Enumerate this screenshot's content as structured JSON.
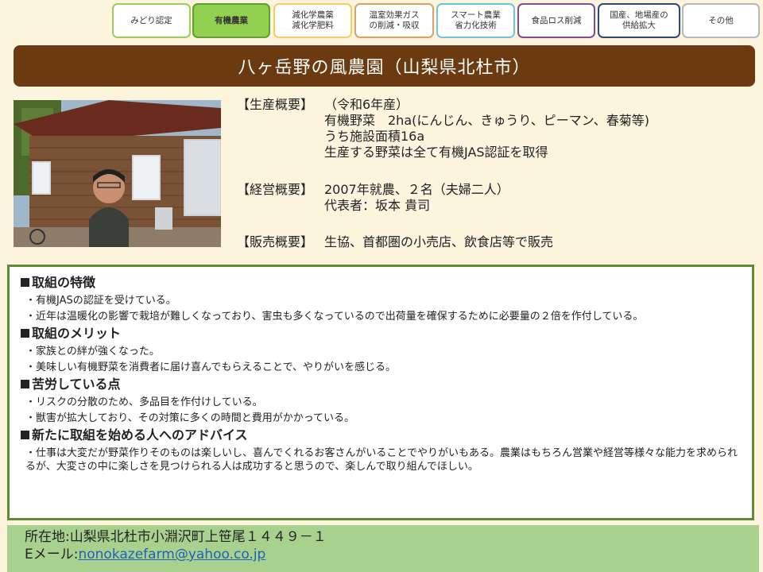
{
  "tabs": [
    {
      "label": "みどり認定",
      "color": "#9ccc5c",
      "active": false
    },
    {
      "label": "有機農業",
      "color": "#5fa02e",
      "active": true,
      "fill": "#92d050"
    },
    {
      "label": "減化学農薬\n減化学肥料",
      "color": "#f0d060",
      "active": false
    },
    {
      "label": "温室効果ガス\nの削減・吸収",
      "color": "#d9a36a",
      "active": false
    },
    {
      "label": "スマート農業\n省力化技術",
      "color": "#6cc7da",
      "active": false
    },
    {
      "label": "食品ロス削減",
      "color": "#7d4d9c",
      "active": false
    },
    {
      "label": "国産、地場産の\n供給拡大",
      "color": "#2e4a7a",
      "active": false
    },
    {
      "label": "その他",
      "color": "#b8b8b8",
      "active": false
    }
  ],
  "page_title": "八ヶ岳野の風農園（山梨県北杜市）",
  "summary": {
    "production": {
      "label": "【生産概要】",
      "lines": [
        "（令和6年産）",
        "有機野菜　2ha(にんじん、きゅうり、ピーマン、春菊等)",
        "うち施設面積16a",
        "生産する野菜は全て有機JAS認証を取得"
      ]
    },
    "management": {
      "label": "【経営概要】",
      "lines": [
        "2007年就農、２名（夫婦二人）",
        "代表者：坂本 貴司"
      ]
    },
    "sales": {
      "label": "【販売概要】",
      "lines": [
        "生協、首都圏の小売店、飲食店等で販売"
      ]
    }
  },
  "sections": [
    {
      "title": "取組の特徴",
      "items": [
        "・有機JASの認証を受けている。",
        "・近年は温暖化の影響で栽培が難しくなっており、害虫も多くなっているので出荷量を確保するために必要量の２倍を作付している。"
      ]
    },
    {
      "title": "取組のメリット",
      "items": [
        "・家族との絆が強くなった。",
        "・美味しい有機野菜を消費者に届け喜んでもらえることで、やりがいを感じる。"
      ]
    },
    {
      "title": "苦労している点",
      "items": [
        "・リスクの分散のため、多品目を作付けしている。",
        "・獣害が拡大しており、その対策に多くの時間と費用がかかっている。"
      ]
    },
    {
      "title": "新たに取組を始める人へのアドバイス",
      "items": [
        "・仕事は大変だが野菜作りそのものは楽しいし、喜んでくれるお客さんがいることでやりがいもある。農業はもちろん営業や経営等様々な能力を求められるが、大変さの中に楽しさを見つけられる人は成功すると思うので、楽しんで取り組んでほしい。"
      ]
    }
  ],
  "footer": {
    "address": "所在地:山梨県北杜市小淵沢町上笹尾１４４９－１",
    "email_label": "Eメール:",
    "email": "nonokazefarm@yahoo.co.jp"
  },
  "colors": {
    "title_bar": "#6b3a10",
    "box_border": "#5f8a3a",
    "footer_bg": "#a9d18e",
    "page_bg": "#fdf4de"
  }
}
